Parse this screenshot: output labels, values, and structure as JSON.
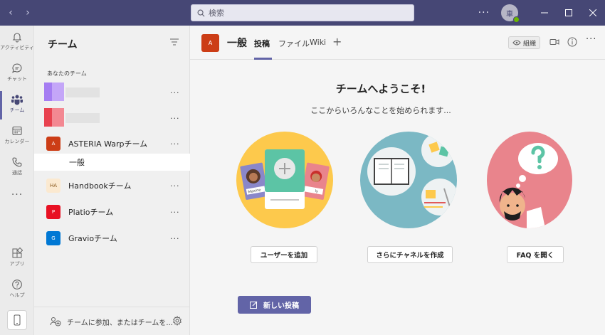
{
  "search": {
    "placeholder": "検索"
  },
  "titlebar": {
    "avatar_initial": "車"
  },
  "rail": {
    "items": [
      {
        "label": "アクティビティ"
      },
      {
        "label": "チャット"
      },
      {
        "label": "チーム"
      },
      {
        "label": "カレンダー"
      },
      {
        "label": "通話"
      },
      {
        "label": "アプリ"
      },
      {
        "label": "ヘルプ"
      }
    ]
  },
  "teams_panel": {
    "title": "チーム",
    "section_label": "あなたのチーム",
    "teams": [
      {
        "initials": "A",
        "name": "ASTERIA Warpチーム",
        "color": "#cc3d16"
      },
      {
        "initials": "HA",
        "name": "Handbookチーム",
        "color": "#fbe9d0"
      },
      {
        "initials": "P",
        "name": "Platioチーム",
        "color": "#e81123"
      },
      {
        "initials": "G",
        "name": "Gravioチーム",
        "color": "#0078d4"
      }
    ],
    "channel": "一般",
    "join_text": "チームに参加、またはチームを..."
  },
  "channel_header": {
    "avatar_initial": "A",
    "title": "一般",
    "tabs": [
      {
        "label": "投稿"
      },
      {
        "label": "ファイル"
      },
      {
        "label": "Wiki"
      }
    ],
    "org_button": "組織"
  },
  "main": {
    "welcome_title": "チームへようこそ!",
    "welcome_sub": "ここからいろんなことを始められます...",
    "card_names": {
      "left": "Maxine",
      "right": "ly"
    },
    "actions": [
      {
        "label": "ユーザーを追加"
      },
      {
        "label": "さらにチャネルを作成"
      },
      {
        "label": "FAQ を開く"
      }
    ],
    "new_post": "新しい投稿"
  },
  "colors": {
    "accent": "#6264a7",
    "titlebar": "#464775",
    "yellow_circle": "#fdc94c",
    "teal_circle": "#7bb8c4",
    "pink_circle": "#e9848c"
  }
}
